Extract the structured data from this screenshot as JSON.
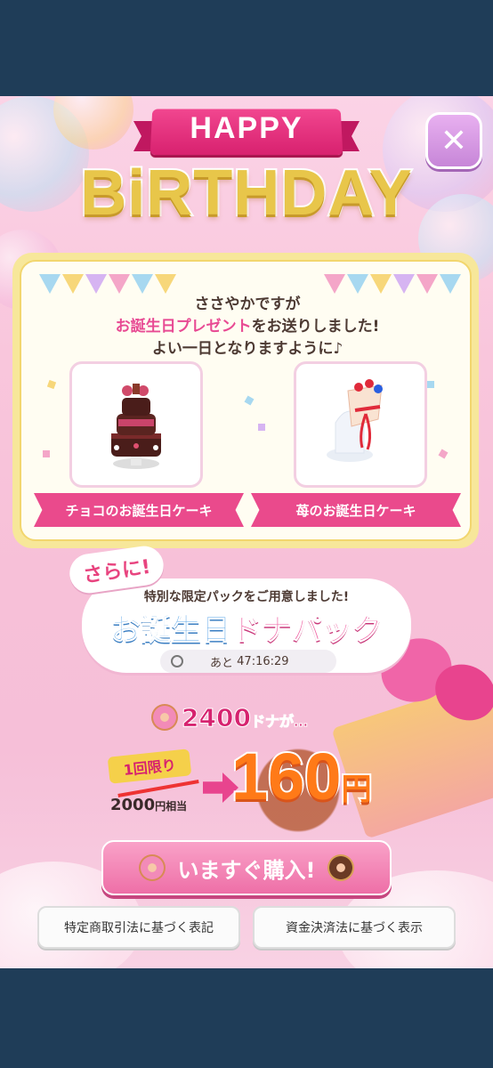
{
  "header": {
    "happy": "HAPPY",
    "birthday": "BiRTHDAY",
    "close_icon": "close-icon"
  },
  "message": {
    "line1": "ささやかですが",
    "line2_highlight": "お誕生日プレゼント",
    "line2_rest": "をお送りしました!",
    "line3": "よい一日となりますように♪"
  },
  "gifts": [
    {
      "label": "チョコのお誕生日ケーキ",
      "icon": "chocolate-cake-icon"
    },
    {
      "label": "苺のお誕生日ケーキ",
      "icon": "strawberry-cake-icon"
    }
  ],
  "offer": {
    "tag": "さらに!",
    "subtitle": "特別な限定パックをご用意しました!",
    "title_part1": "お誕生日",
    "title_part2": "ドナパック",
    "timer_prefix": "あと",
    "timer_value": "47:16:29",
    "donut_amount": "2400",
    "donut_suffix": "ドナが…",
    "once_badge": "1回限り",
    "old_price": "2000",
    "old_price_suffix": "円相当",
    "new_price": "160",
    "new_price_unit": "円"
  },
  "buy_button": {
    "label": "いますぐ購入!"
  },
  "legal": {
    "left": "特定商取引法に基づく表記",
    "right": "資金決済法に基づく表示"
  },
  "colors": {
    "accent_pink": "#ea4a8c",
    "gold": "#e8c64a",
    "price_orange": "#ff7a18",
    "background": "#1f3d58"
  }
}
